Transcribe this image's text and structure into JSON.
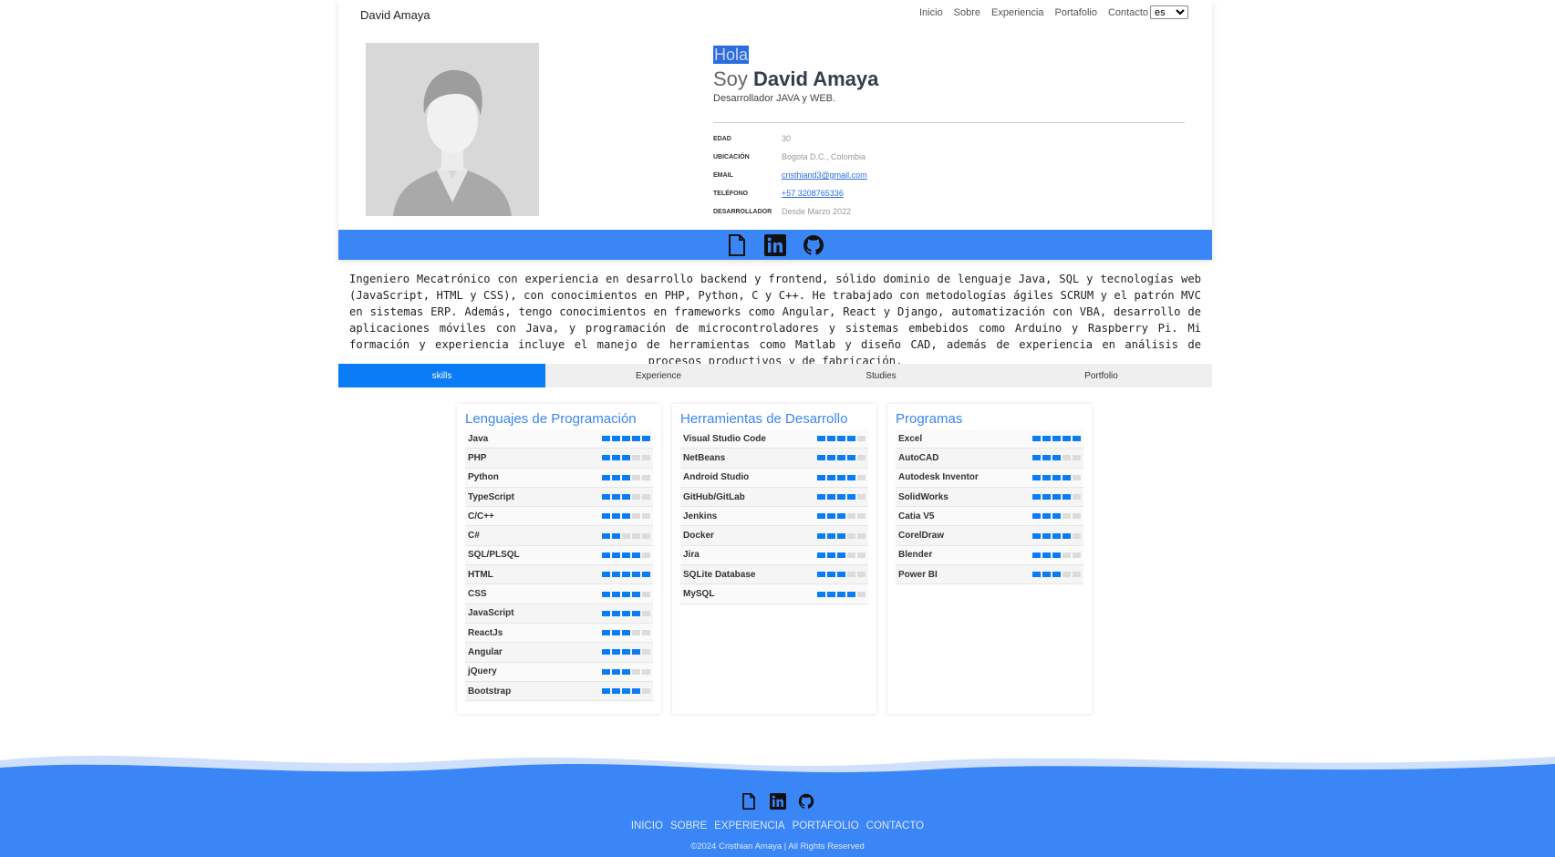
{
  "header": {
    "brand": "David Amaya",
    "nav": [
      "Inicio",
      "Sobre",
      "Experiencia",
      "Portafolio",
      "Contacto"
    ],
    "language_selected": "es"
  },
  "intro": {
    "greeting": "Hola",
    "soy": "Soy ",
    "name": "David Amaya",
    "role": "Desarrollador JAVA y WEB."
  },
  "info": [
    {
      "key": "EDAD",
      "value": "30"
    },
    {
      "key": "UBICACIÓN",
      "value": "Bogota D.C., Colombia"
    },
    {
      "key": "EMAIL",
      "value": "cristhiand3@gmail.com"
    },
    {
      "key": "TELÉFONO",
      "value": "+57 3208765336"
    },
    {
      "key": "DESARROLLADOR",
      "value": "Desde Marzo 2022"
    }
  ],
  "social_icons": [
    "document-icon",
    "linkedin-icon",
    "github-icon"
  ],
  "about": "Ingeniero Mecatrónico con experiencia en desarrollo backend y frontend, sólido dominio de lenguaje Java, SQL y tecnologías web (JavaScript, HTML y CSS), con conocimientos en PHP, Python, C y C++. He trabajado con metodologías ágiles SCRUM y el patrón MVC en sistemas ERP. Además, tengo conocimientos en frameworks como Angular, React y Django, automatización con VBA, desarrollo de aplicaciones móviles con Java, y programación de microcontroladores y sistemas embebidos como Arduino y Raspberry Pi. Mi formación y experiencia incluye el manejo de herramientas como Matlab y diseño CAD, además de experiencia en análisis de procesos productivos y de fabricación.",
  "tabs": [
    "skills",
    "Experience",
    "Studies",
    "Portfolio"
  ],
  "panels": [
    {
      "title": "Lenguajes de Programación",
      "skills": [
        {
          "name": "Java",
          "level": 5
        },
        {
          "name": "PHP",
          "level": 3
        },
        {
          "name": "Python",
          "level": 3
        },
        {
          "name": "TypeScript",
          "level": 3
        },
        {
          "name": "C/C++",
          "level": 3
        },
        {
          "name": "C#",
          "level": 2
        },
        {
          "name": "SQL/PLSQL",
          "level": 4
        },
        {
          "name": "HTML",
          "level": 5
        },
        {
          "name": "CSS",
          "level": 4
        },
        {
          "name": "JavaScript",
          "level": 4
        },
        {
          "name": "ReactJs",
          "level": 3
        },
        {
          "name": "Angular",
          "level": 4
        },
        {
          "name": "jQuery",
          "level": 3
        },
        {
          "name": "Bootstrap",
          "level": 4
        }
      ]
    },
    {
      "title": "Herramientas de Desarrollo",
      "skills": [
        {
          "name": "Visual Studio Code",
          "level": 4
        },
        {
          "name": "NetBeans",
          "level": 4
        },
        {
          "name": "Android Studio",
          "level": 4
        },
        {
          "name": "GitHub/GitLab",
          "level": 4
        },
        {
          "name": "Jenkins",
          "level": 3
        },
        {
          "name": "Docker",
          "level": 3
        },
        {
          "name": "Jira",
          "level": 3
        },
        {
          "name": "SQLite Database",
          "level": 3
        },
        {
          "name": "MySQL",
          "level": 4
        }
      ]
    },
    {
      "title": "Programas",
      "skills": [
        {
          "name": "Excel",
          "level": 5
        },
        {
          "name": "AutoCAD",
          "level": 3
        },
        {
          "name": "Autodesk Inventor",
          "level": 4
        },
        {
          "name": "SolidWorks",
          "level": 4
        },
        {
          "name": "Catia V5",
          "level": 3
        },
        {
          "name": "CorelDraw",
          "level": 4
        },
        {
          "name": "Blender",
          "level": 3
        },
        {
          "name": "Power BI",
          "level": 3
        }
      ]
    }
  ],
  "footer": {
    "links": [
      "INICIO",
      "SOBRE",
      "EXPERIENCIA",
      "PORTAFOLIO",
      "CONTACTO"
    ],
    "copyright": "©2024 Cristhian Amaya | All Rights Reserved"
  },
  "colors": {
    "accent": "#0a7cf5",
    "social_bar": "#3b86f7",
    "footer_wave": "#3b86f7",
    "footer_wave_light": "#cfe0fc"
  }
}
